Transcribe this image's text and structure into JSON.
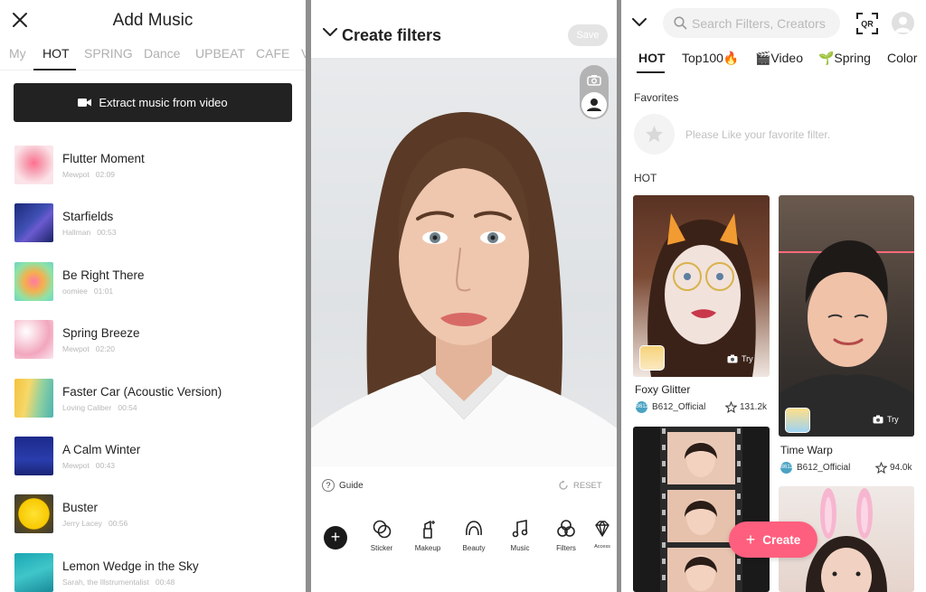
{
  "music": {
    "title": "Add Music",
    "tabs": [
      "My",
      "HOT",
      "SPRING",
      "Dance",
      "UPBEAT",
      "CAFE",
      "V"
    ],
    "active_tab": "HOT",
    "extract_label": "Extract music from video",
    "songs": [
      {
        "title": "Flutter Moment",
        "artist": "Mewpot",
        "duration": "02:09"
      },
      {
        "title": "Starfields",
        "artist": "Hallman",
        "duration": "00:53"
      },
      {
        "title": "Be Right There",
        "artist": "oomiee",
        "duration": "01:01"
      },
      {
        "title": "Spring Breeze",
        "artist": "Mewpot",
        "duration": "02:20"
      },
      {
        "title": "Faster Car (Acoustic Version)",
        "artist": "Loving Caliber",
        "duration": "00:54"
      },
      {
        "title": "A Calm Winter",
        "artist": "Mewpot",
        "duration": "00:43"
      },
      {
        "title": "Buster",
        "artist": "Jerry Lacey",
        "duration": "00:56"
      },
      {
        "title": "Lemon Wedge in the Sky",
        "artist": "Sarah, the Illstrumentalist",
        "duration": "00:48"
      }
    ]
  },
  "create": {
    "title": "Create filters",
    "save_label": "Save",
    "guide_label": "Guide",
    "guide_icon": "?",
    "reset_label": "RESET",
    "add_symbol": "+",
    "tools": [
      "Sticker",
      "Makeup",
      "Beauty",
      "Music",
      "Filters",
      "Access"
    ]
  },
  "discover": {
    "search_placeholder": "Search Filters, Creators",
    "qr_label": "QR",
    "tabs": [
      "HOT",
      "Top100🔥",
      "🎬Video",
      "🌱Spring",
      "Color"
    ],
    "active_tab": "HOT",
    "favorites_label": "Favorites",
    "favorites_hint": "Please Like your favorite filter.",
    "hot_label": "HOT",
    "cards": [
      {
        "name": "Foxy Glitter",
        "creator": "B612_Official",
        "likes": "131.2k",
        "try_label": "Try"
      },
      {
        "name": "Time Warp",
        "creator": "B612_Official",
        "likes": "94.0k",
        "try_label": "Try"
      }
    ],
    "creator_badge": "B612",
    "create_label": "Create",
    "create_symbol": "+"
  },
  "colors": {
    "accent_pink": "#ff5f7e",
    "dark": "#222222"
  }
}
